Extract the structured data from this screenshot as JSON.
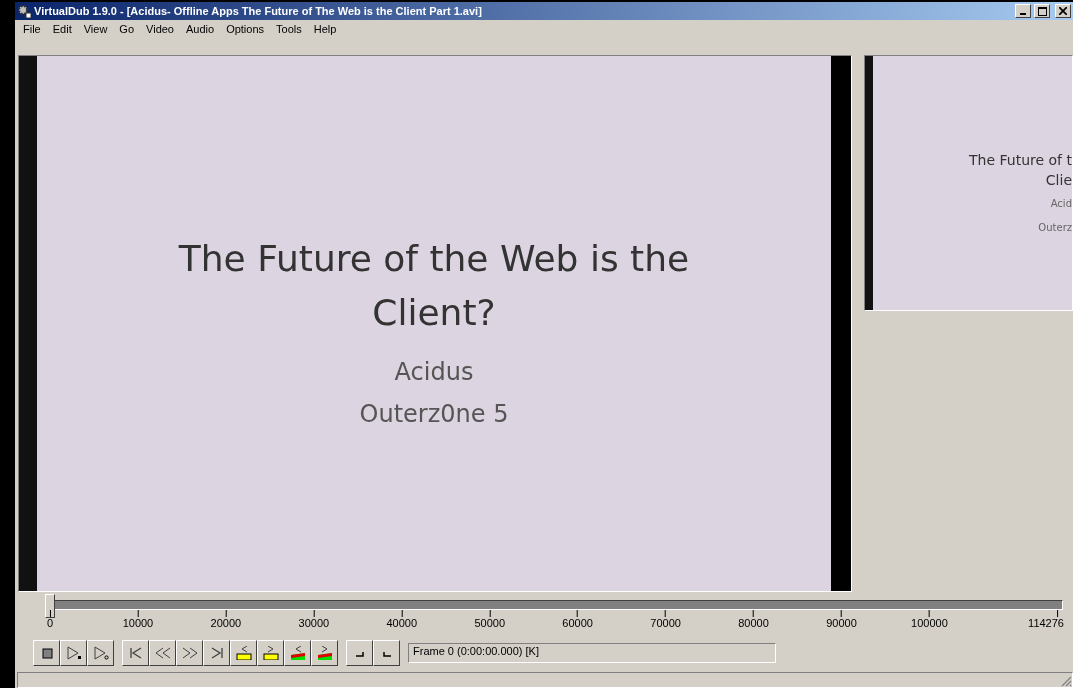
{
  "window": {
    "title": "VirtualDub 1.9.0 - [Acidus- Offline Apps The Future of The Web is the Client Part 1.avi]"
  },
  "menu": [
    "File",
    "Edit",
    "View",
    "Go",
    "Video",
    "Audio",
    "Options",
    "Tools",
    "Help"
  ],
  "input_pane": {
    "title": "The Future of the Web is the Client?",
    "author": "Acidus",
    "event": "Outerz0ne 5"
  },
  "output_pane": {
    "lines": [
      "The Future of t",
      "Clie",
      "Acid",
      "Outerz"
    ]
  },
  "timeline": {
    "level": 0,
    "ticks": [
      "0",
      "10000",
      "20000",
      "30000",
      "40000",
      "50000",
      "60000",
      "70000",
      "80000",
      "90000",
      "100000",
      "114276"
    ]
  },
  "toolbar": {
    "groups": [
      [
        {
          "kind": "stop"
        },
        {
          "kind": "play-input"
        },
        {
          "kind": "play-output"
        }
      ],
      [
        {
          "kind": "start"
        },
        {
          "kind": "prev-key"
        },
        {
          "kind": "next-key"
        },
        {
          "kind": "end"
        },
        {
          "kind": "key-back"
        },
        {
          "kind": "key-fwd"
        },
        {
          "kind": "scene-back"
        },
        {
          "kind": "scene-fwd"
        }
      ],
      [
        {
          "kind": "mark-in"
        },
        {
          "kind": "mark-out"
        }
      ]
    ]
  },
  "frame_readout": "Frame 0 (0:00:00.000) [K]"
}
